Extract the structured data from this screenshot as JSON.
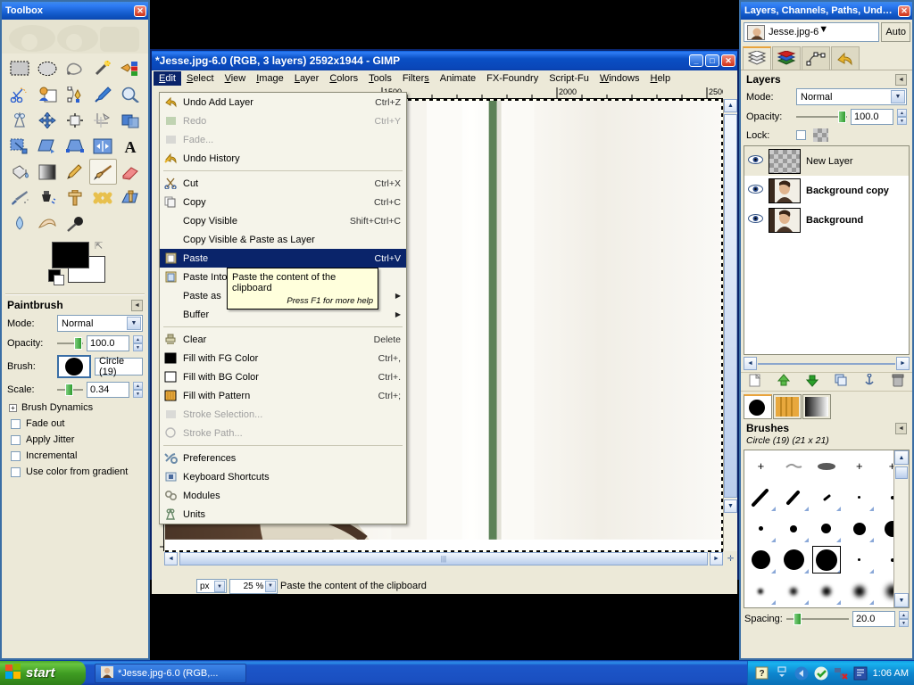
{
  "toolbox": {
    "title": "Toolbox",
    "close_label": "✕",
    "tools": [
      {
        "name": "rect-select-tool"
      },
      {
        "name": "ellipse-select-tool"
      },
      {
        "name": "free-select-tool"
      },
      {
        "name": "fuzzy-select-tool"
      },
      {
        "name": "select-by-color-tool"
      },
      {
        "name": "scissors-select-tool"
      },
      {
        "name": "foreground-select-tool"
      },
      {
        "name": "paths-tool"
      },
      {
        "name": "color-picker-tool"
      },
      {
        "name": "zoom-tool"
      },
      {
        "name": "measure-tool"
      },
      {
        "name": "move-tool"
      },
      {
        "name": "alignment-tool"
      },
      {
        "name": "crop-tool"
      },
      {
        "name": "rotate-tool"
      },
      {
        "name": "scale-tool"
      },
      {
        "name": "shear-tool"
      },
      {
        "name": "perspective-tool"
      },
      {
        "name": "flip-tool"
      },
      {
        "name": "text-tool"
      },
      {
        "name": "bucket-fill-tool"
      },
      {
        "name": "gradient-tool"
      },
      {
        "name": "pencil-tool"
      },
      {
        "name": "paintbrush-tool"
      },
      {
        "name": "eraser-tool"
      },
      {
        "name": "airbrush-tool"
      },
      {
        "name": "ink-tool"
      },
      {
        "name": "clone-tool"
      },
      {
        "name": "heal-tool"
      },
      {
        "name": "perspective-clone-tool"
      },
      {
        "name": "blur-sharpen-tool"
      },
      {
        "name": "smudge-tool"
      },
      {
        "name": "dodge-burn-tool"
      }
    ],
    "selected_tool": "paintbrush-tool",
    "fg_color": "#000000",
    "bg_color": "#ffffff",
    "options": {
      "title": "Paintbrush",
      "mode_label": "Mode:",
      "mode_value": "Normal",
      "opacity_label": "Opacity:",
      "opacity_value": "100.0",
      "brush_label": "Brush:",
      "brush_value": "Circle (19)",
      "scale_label": "Scale:",
      "scale_value": "0.34",
      "brush_dynamics_label": "Brush Dynamics",
      "checkboxes": [
        {
          "label": "Fade out",
          "checked": false
        },
        {
          "label": "Apply Jitter",
          "checked": false
        },
        {
          "label": "Incremental",
          "checked": false
        },
        {
          "label": "Use color from gradient",
          "checked": false
        }
      ]
    }
  },
  "image_window": {
    "title": "*Jesse.jpg-6.0 (RGB, 3 layers) 2592x1944 - GIMP",
    "minimize_label": "_",
    "maximize_label": "□",
    "close_label": "✕",
    "menus": [
      "Edit",
      "Select",
      "View",
      "Image",
      "Layer",
      "Colors",
      "Tools",
      "Filters",
      "Animate",
      "FX-Foundry",
      "Script-Fu",
      "Windows",
      "Help"
    ],
    "open_menu": "Edit",
    "ruler_ticks": [
      "1500",
      "2000",
      "2500"
    ],
    "statusbar": {
      "unit": "px",
      "zoom": "25 %",
      "message": "Paste the content of the clipboard"
    }
  },
  "edit_menu": {
    "items": [
      {
        "label": "Undo Add Layer",
        "accel": "Ctrl+Z",
        "icon": "undo-icon",
        "disabled": false,
        "highlighted": false,
        "submenu": false
      },
      {
        "label": "Redo",
        "accel": "Ctrl+Y",
        "icon": "redo-icon",
        "disabled": true,
        "highlighted": false,
        "submenu": false
      },
      {
        "label": "Fade...",
        "accel": "",
        "icon": "fade-icon",
        "disabled": true,
        "highlighted": false,
        "submenu": false
      },
      {
        "label": "Undo History",
        "accel": "",
        "icon": "undo-history-icon",
        "disabled": false,
        "highlighted": false,
        "submenu": false
      },
      {
        "separator": true
      },
      {
        "label": "Cut",
        "accel": "Ctrl+X",
        "icon": "cut-icon",
        "disabled": false,
        "highlighted": false,
        "submenu": false
      },
      {
        "label": "Copy",
        "accel": "Ctrl+C",
        "icon": "copy-icon",
        "disabled": false,
        "highlighted": false,
        "submenu": false
      },
      {
        "label": "Copy Visible",
        "accel": "Shift+Ctrl+C",
        "icon": "",
        "disabled": false,
        "highlighted": false,
        "submenu": false
      },
      {
        "label": "Copy Visible & Paste as Layer",
        "accel": "",
        "icon": "",
        "disabled": false,
        "highlighted": false,
        "submenu": false
      },
      {
        "label": "Paste",
        "accel": "Ctrl+V",
        "icon": "paste-icon",
        "disabled": false,
        "highlighted": true,
        "submenu": false
      },
      {
        "label": "Paste Into",
        "accel": "",
        "icon": "paste-into-icon",
        "disabled": false,
        "highlighted": false,
        "submenu": false
      },
      {
        "label": "Paste as",
        "accel": "",
        "icon": "",
        "disabled": false,
        "highlighted": false,
        "submenu": true
      },
      {
        "label": "Buffer",
        "accel": "",
        "icon": "",
        "disabled": false,
        "highlighted": false,
        "submenu": true
      },
      {
        "separator": true
      },
      {
        "label": "Clear",
        "accel": "Delete",
        "icon": "clear-icon",
        "disabled": false,
        "highlighted": false,
        "submenu": false
      },
      {
        "label": "Fill with FG Color",
        "accel": "Ctrl+,",
        "icon": "fg-color-icon",
        "disabled": false,
        "highlighted": false,
        "submenu": false
      },
      {
        "label": "Fill with BG Color",
        "accel": "Ctrl+.",
        "icon": "bg-color-icon",
        "disabled": false,
        "highlighted": false,
        "submenu": false
      },
      {
        "label": "Fill with Pattern",
        "accel": "Ctrl+;",
        "icon": "pattern-icon",
        "disabled": false,
        "highlighted": false,
        "submenu": false
      },
      {
        "label": "Stroke Selection...",
        "accel": "",
        "icon": "stroke-selection-icon",
        "disabled": true,
        "highlighted": false,
        "submenu": false
      },
      {
        "label": "Stroke Path...",
        "accel": "",
        "icon": "stroke-path-icon",
        "disabled": true,
        "highlighted": false,
        "submenu": false
      },
      {
        "separator": true
      },
      {
        "label": "Preferences",
        "accel": "",
        "icon": "preferences-icon",
        "disabled": false,
        "highlighted": false,
        "submenu": false
      },
      {
        "label": "Keyboard Shortcuts",
        "accel": "",
        "icon": "keyboard-icon",
        "disabled": false,
        "highlighted": false,
        "submenu": false
      },
      {
        "label": "Modules",
        "accel": "",
        "icon": "modules-icon",
        "disabled": false,
        "highlighted": false,
        "submenu": false
      },
      {
        "label": "Units",
        "accel": "",
        "icon": "units-icon",
        "disabled": false,
        "highlighted": false,
        "submenu": false
      }
    ]
  },
  "tooltip": {
    "text": "Paste the content of the clipboard",
    "help": "Press F1 for more help"
  },
  "dock": {
    "title": "Layers, Channels, Paths, Undo -...",
    "close_label": "✕",
    "image_name": "Jesse.jpg-6",
    "auto_label": "Auto",
    "tabs": [
      {
        "name": "layers-tab"
      },
      {
        "name": "channels-tab"
      },
      {
        "name": "paths-tab"
      },
      {
        "name": "undo-history-tab"
      }
    ],
    "active_tab": "layers-tab",
    "layers_panel": {
      "title": "Layers",
      "mode_label": "Mode:",
      "mode_value": "Normal",
      "opacity_label": "Opacity:",
      "opacity_value": "100.0",
      "lock_label": "Lock:",
      "layers": [
        {
          "name": "New Layer",
          "visible": true,
          "selected": true,
          "thumb": "transparent",
          "bold": false
        },
        {
          "name": "Background copy",
          "visible": true,
          "selected": false,
          "thumb": "photo",
          "bold": true
        },
        {
          "name": "Background",
          "visible": true,
          "selected": false,
          "thumb": "photo",
          "bold": true
        }
      ],
      "buttons": [
        {
          "name": "new-layer-button"
        },
        {
          "name": "raise-layer-button"
        },
        {
          "name": "lower-layer-button"
        },
        {
          "name": "duplicate-layer-button"
        },
        {
          "name": "anchor-layer-button"
        },
        {
          "name": "delete-layer-button"
        }
      ]
    },
    "brushes_panel": {
      "tabs": [
        {
          "name": "brushes-tab"
        },
        {
          "name": "patterns-tab"
        },
        {
          "name": "gradients-tab"
        }
      ],
      "active_tab": "brushes-tab",
      "title": "Brushes",
      "current_brush": "Circle (19) (21 x 21)",
      "spacing_label": "Spacing:",
      "spacing_value": "20.0",
      "selected_index": 12
    }
  },
  "taskbar": {
    "start_label": "start",
    "items": [
      {
        "label": "*Jesse.jpg-6.0 (RGB,...",
        "icon": "gimp-window-icon"
      }
    ],
    "tray_icons": [
      "help-icon",
      "network-icon",
      "shield-icon",
      "updates-icon",
      "monitor-icon"
    ],
    "clock": "1:06 AM"
  },
  "colors": {
    "xp_blue": "#0a46b8",
    "panel_bg": "#ece9d8",
    "menu_highlight": "#0a246a",
    "tooltip_bg": "#ffffdc",
    "accent_orange": "#e8a33d"
  }
}
